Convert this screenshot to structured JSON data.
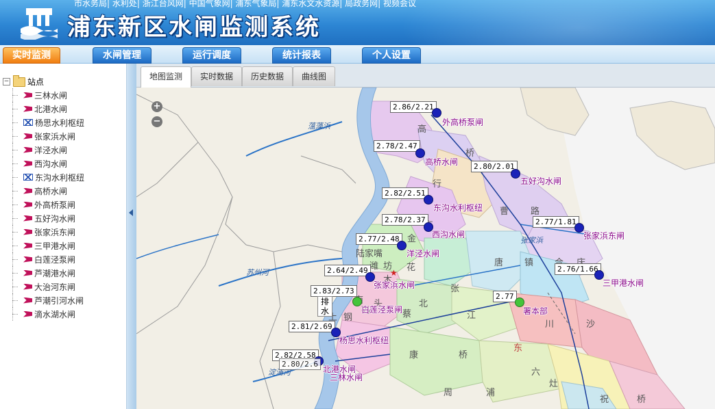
{
  "header": {
    "top_links": "市水务局| 水利处| 浙江台风网| 中国气象网| 浦东气象局| 浦东水文水资源| 局政务网| 视频会议",
    "system_title": "浦东新区水闸监测系统"
  },
  "nav": {
    "items": [
      "实时监测",
      "水闸管理",
      "运行调度",
      "统计报表",
      "个人设置"
    ],
    "active_index": 0
  },
  "sidebar": {
    "root_label": "站点",
    "items": [
      {
        "label": "三林水闸",
        "icon": "gate-icon"
      },
      {
        "label": "北港水闸",
        "icon": "gate-icon"
      },
      {
        "label": "杨思水利枢纽",
        "icon": "hub-icon"
      },
      {
        "label": "张家浜水闸",
        "icon": "gate-icon"
      },
      {
        "label": "洋泾水闸",
        "icon": "gate-icon"
      },
      {
        "label": "西沟水闸",
        "icon": "gate-icon"
      },
      {
        "label": "东沟水利枢纽",
        "icon": "hub-icon"
      },
      {
        "label": "高桥水闸",
        "icon": "gate-icon"
      },
      {
        "label": "外高桥泵闸",
        "icon": "gate-icon"
      },
      {
        "label": "五好沟水闸",
        "icon": "gate-icon"
      },
      {
        "label": "张家浜东闸",
        "icon": "gate-icon"
      },
      {
        "label": "三甲港水闸",
        "icon": "gate-icon"
      },
      {
        "label": "白莲泾泵闸",
        "icon": "gate-icon"
      },
      {
        "label": "芦潮港水闸",
        "icon": "gate-icon"
      },
      {
        "label": "大治河东闸",
        "icon": "gate-icon"
      },
      {
        "label": "芦潮引河水闸",
        "icon": "gate-icon"
      },
      {
        "label": "滴水湖水闸",
        "icon": "gate-icon"
      }
    ]
  },
  "tabs": {
    "items": [
      "地图监测",
      "实时数据",
      "历史数据",
      "曲线图"
    ],
    "active_index": 0
  },
  "map": {
    "zoom_in": "+",
    "zoom_out": "−",
    "discharge_label": "排水",
    "stations": [
      {
        "name": "外高桥泵闸",
        "value": "2.86/2.21",
        "status": "blue"
      },
      {
        "name": "高桥水闸",
        "value": "2.78/2.47",
        "status": "blue"
      },
      {
        "name": "五好沟水闸",
        "value": "2.80/2.01",
        "status": "blue"
      },
      {
        "name": "东沟水利枢纽",
        "value": "2.82/2.51",
        "status": "blue"
      },
      {
        "name": "西沟水闸",
        "value": "2.78/2.37",
        "status": "blue"
      },
      {
        "name": "张家浜东闸",
        "value": "2.77/1.81",
        "status": "blue"
      },
      {
        "name": "洋泾水闸",
        "value": "2.77/2.48",
        "status": "blue"
      },
      {
        "name": "三甲港水闸",
        "value": "2.76/1.66",
        "status": "blue"
      },
      {
        "name": "张家浜水闸",
        "value": "2.64/2.49",
        "status": "blue"
      },
      {
        "name": "白莲泾泵闸",
        "value": "2.83/2.73",
        "status": "green"
      },
      {
        "name": "署本部",
        "value": "2.77",
        "status": "green"
      },
      {
        "name": "杨思水利枢纽",
        "value": "2.81/2.69",
        "status": "blue"
      },
      {
        "name": "北港水闸",
        "value": "2.82/2.58",
        "status": "blue"
      },
      {
        "name": "三林水闸",
        "value": "2.80/2.6",
        "status": "blue"
      }
    ],
    "place_labels": [
      "高",
      "桥",
      "行",
      "曹",
      "路",
      "金",
      "东",
      "张",
      "唐",
      "镇",
      "合",
      "庆",
      "北",
      "蔡",
      "江",
      "川",
      "沙",
      "康",
      "桥",
      "周",
      "浦",
      "六",
      "灶",
      "祝",
      "桥",
      "上",
      "钢",
      "南",
      "码",
      "头",
      "陆家嘴",
      "潍",
      "坊",
      "花",
      "木",
      "东"
    ],
    "river_labels": [
      "苏州河",
      "蕰藻浜",
      "张家浜",
      "淀浦河"
    ]
  }
}
